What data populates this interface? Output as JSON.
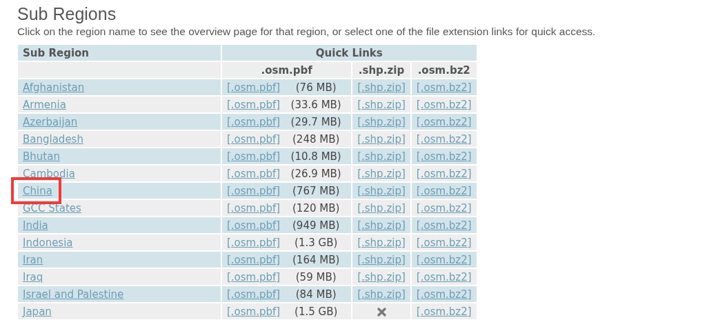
{
  "title": "Sub Regions",
  "description": "Click on the region name to see the overview page for that region, or select one of the file extension links for quick access.",
  "table": {
    "columns": [
      "Sub Region",
      "Quick Links"
    ],
    "subcolumns": [
      ".osm.pbf",
      ".shp.zip",
      ".osm.bz2"
    ],
    "rows": [
      {
        "name": "Afghanistan",
        "pbf": "[.osm.pbf]",
        "size": "(76 MB)",
        "shp": "[.shp.zip]",
        "bz2": "[.osm.bz2]",
        "highlighted": false
      },
      {
        "name": "Armenia",
        "pbf": "[.osm.pbf]",
        "size": "(33.6 MB)",
        "shp": "[.shp.zip]",
        "bz2": "[.osm.bz2]",
        "highlighted": false
      },
      {
        "name": "Azerbaijan",
        "pbf": "[.osm.pbf]",
        "size": "(29.7 MB)",
        "shp": "[.shp.zip]",
        "bz2": "[.osm.bz2]",
        "highlighted": false
      },
      {
        "name": "Bangladesh",
        "pbf": "[.osm.pbf]",
        "size": "(248 MB)",
        "shp": "[.shp.zip]",
        "bz2": "[.osm.bz2]",
        "highlighted": false
      },
      {
        "name": "Bhutan",
        "pbf": "[.osm.pbf]",
        "size": "(10.8 MB)",
        "shp": "[.shp.zip]",
        "bz2": "[.osm.bz2]",
        "highlighted": false
      },
      {
        "name": "Cambodia",
        "pbf": "[.osm.pbf]",
        "size": "(26.9 MB)",
        "shp": "[.shp.zip]",
        "bz2": "[.osm.bz2]",
        "highlighted": false
      },
      {
        "name": "China",
        "pbf": "[.osm.pbf]",
        "size": "(767 MB)",
        "shp": "[.shp.zip]",
        "bz2": "[.osm.bz2]",
        "highlighted": true
      },
      {
        "name": "GCC States",
        "pbf": "[.osm.pbf]",
        "size": "(120 MB)",
        "shp": "[.shp.zip]",
        "bz2": "[.osm.bz2]",
        "highlighted": false
      },
      {
        "name": "India",
        "pbf": "[.osm.pbf]",
        "size": "(949 MB)",
        "shp": "[.shp.zip]",
        "bz2": "[.osm.bz2]",
        "highlighted": false
      },
      {
        "name": "Indonesia",
        "pbf": "[.osm.pbf]",
        "size": "(1.3 GB)",
        "shp": "[.shp.zip]",
        "bz2": "[.osm.bz2]",
        "highlighted": false
      },
      {
        "name": "Iran",
        "pbf": "[.osm.pbf]",
        "size": "(164 MB)",
        "shp": "[.shp.zip]",
        "bz2": "[.osm.bz2]",
        "highlighted": false
      },
      {
        "name": "Iraq",
        "pbf": "[.osm.pbf]",
        "size": "(59 MB)",
        "shp": "[.shp.zip]",
        "bz2": "[.osm.bz2]",
        "highlighted": false
      },
      {
        "name": "Israel and Palestine",
        "pbf": "[.osm.pbf]",
        "size": "(84 MB)",
        "shp": "[.shp.zip]",
        "bz2": "[.osm.bz2]",
        "highlighted": false
      },
      {
        "name": "Japan",
        "pbf": "[.osm.pbf]",
        "size": "(1.5 GB)",
        "bz2": "[.osm.bz2]",
        "highlighted": false
      }
    ]
  }
}
